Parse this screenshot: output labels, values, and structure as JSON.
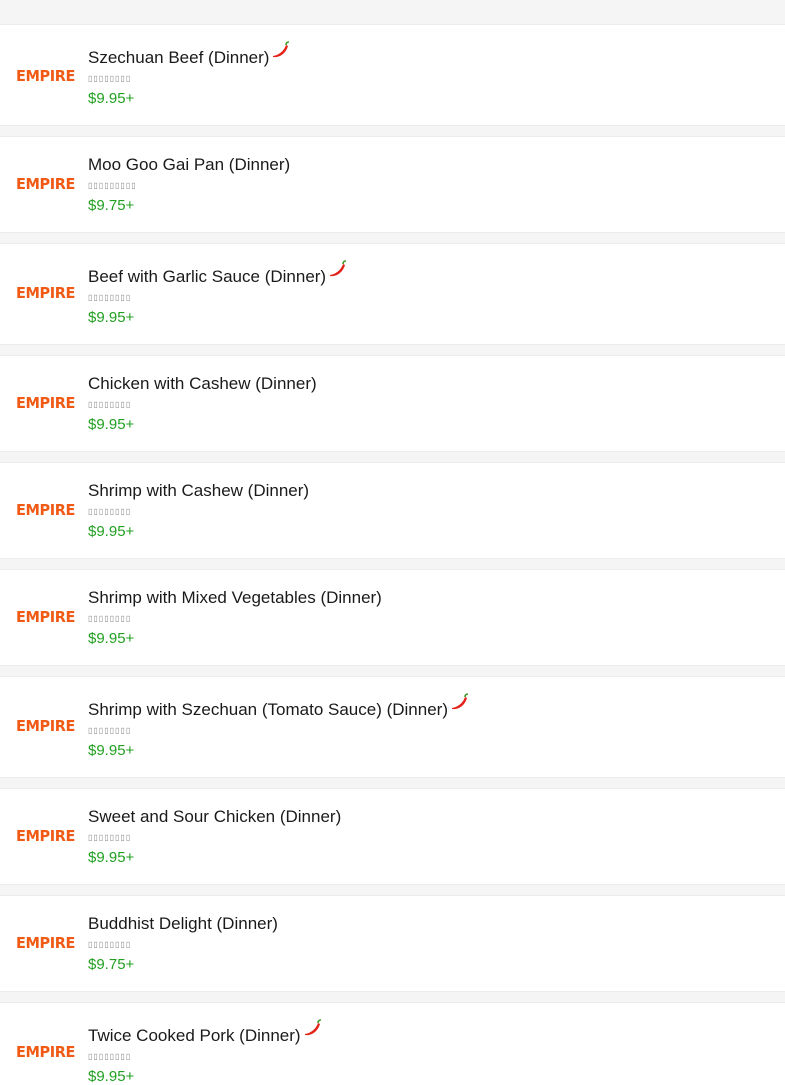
{
  "menu": {
    "items": [
      {
        "logo": "EMPIRE",
        "name": "Szechuan Beef (Dinner)",
        "chinese": "▯▯▯▯▯▯▯▯",
        "price": "$9.95+",
        "spicy": true
      },
      {
        "logo": "EMPIRE",
        "name": "Moo Goo Gai Pan (Dinner)",
        "chinese": "▯▯▯▯▯▯▯▯▯",
        "price": "$9.75+",
        "spicy": false
      },
      {
        "logo": "EMPIRE",
        "name": "Beef with Garlic Sauce (Dinner)",
        "chinese": "▯▯▯▯▯▯▯▯",
        "price": "$9.95+",
        "spicy": true
      },
      {
        "logo": "EMPIRE",
        "name": "Chicken with Cashew (Dinner)",
        "chinese": "▯▯▯▯▯▯▯▯",
        "price": "$9.95+",
        "spicy": false
      },
      {
        "logo": "EMPIRE",
        "name": "Shrimp with Cashew (Dinner)",
        "chinese": "▯▯▯▯▯▯▯▯",
        "price": "$9.95+",
        "spicy": false
      },
      {
        "logo": "EMPIRE",
        "name": "Shrimp with Mixed Vegetables (Dinner)",
        "chinese": "▯▯▯▯▯▯▯▯",
        "price": "$9.95+",
        "spicy": false
      },
      {
        "logo": "EMPIRE",
        "name": "Shrimp with Szechuan (Tomato Sauce) (Dinner)",
        "chinese": "▯▯▯▯▯▯▯▯",
        "price": "$9.95+",
        "spicy": true
      },
      {
        "logo": "EMPIRE",
        "name": "Sweet and Sour Chicken (Dinner)",
        "chinese": "▯▯▯▯▯▯▯▯",
        "price": "$9.95+",
        "spicy": false
      },
      {
        "logo": "EMPIRE",
        "name": "Buddhist Delight (Dinner)",
        "chinese": "▯▯▯▯▯▯▯▯",
        "price": "$9.75+",
        "spicy": false
      },
      {
        "logo": "EMPIRE",
        "name": "Twice Cooked Pork (Dinner)",
        "chinese": "▯▯▯▯▯▯▯▯",
        "price": "$9.95+",
        "spicy": true
      }
    ]
  },
  "colors": {
    "brand": "#f05a14",
    "price": "#22a022",
    "divider": "#f5f5f5",
    "chili": "#e2231a"
  },
  "icons": {
    "chili": "chili-pepper-icon"
  }
}
